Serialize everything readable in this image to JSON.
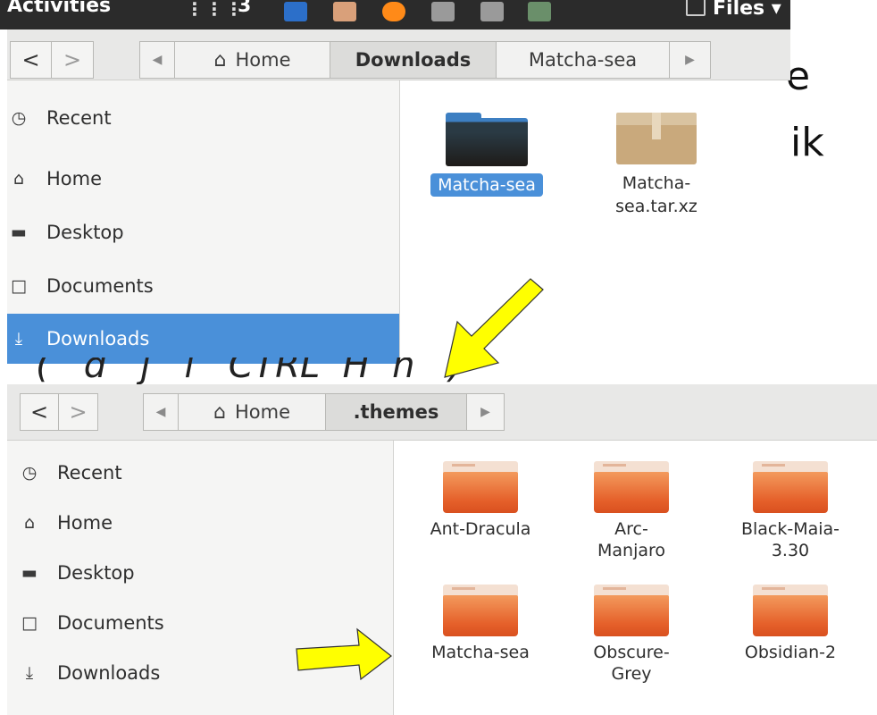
{
  "topbar": {
    "activities": "Activities",
    "workspace": "3",
    "app_menu": "Files ▾"
  },
  "background_text": {
    "line1_fragment": "e",
    "line2_fragment": "ik",
    "line3_fragment": "(   d   j   i   CTRL  H  h   )"
  },
  "window1": {
    "nav": {
      "back": "<",
      "forward": ">"
    },
    "crumbs": [
      {
        "label": "Home",
        "icon": "home-icon"
      },
      {
        "label": "Downloads",
        "active": true
      },
      {
        "label": "Matcha-sea"
      }
    ],
    "sidebar": [
      {
        "label": "Recent",
        "icon": "clock-icon",
        "glyph": "◷"
      },
      {
        "label": "Home",
        "icon": "home-icon",
        "glyph": "⌂"
      },
      {
        "label": "Desktop",
        "icon": "folder-icon",
        "glyph": "▬"
      },
      {
        "label": "Documents",
        "icon": "document-icon",
        "glyph": "□"
      },
      {
        "label": "Downloads",
        "icon": "download-icon",
        "glyph": "⤓",
        "selected": true
      }
    ],
    "files": [
      {
        "name": "Matcha-sea",
        "type": "folder",
        "selected": true
      },
      {
        "name_line1": "Matcha-",
        "name_line2": "sea.tar.xz",
        "type": "archive"
      }
    ]
  },
  "window2": {
    "nav": {
      "back": "<",
      "forward": ">"
    },
    "crumbs": [
      {
        "label": "Home",
        "icon": "home-icon"
      },
      {
        "label": ".themes",
        "active": true
      }
    ],
    "sidebar": [
      {
        "label": "Recent",
        "icon": "clock-icon",
        "glyph": "◷"
      },
      {
        "label": "Home",
        "icon": "home-icon",
        "glyph": "⌂"
      },
      {
        "label": "Desktop",
        "icon": "folder-icon",
        "glyph": "▬"
      },
      {
        "label": "Documents",
        "icon": "document-icon",
        "glyph": "□"
      },
      {
        "label": "Downloads",
        "icon": "download-icon",
        "glyph": "⤓"
      }
    ],
    "folders": [
      {
        "line1": "Ant-Dracula",
        "line2": ""
      },
      {
        "line1": "Arc-",
        "line2": "Manjaro"
      },
      {
        "line1": "Black-Maia-",
        "line2": "3.30"
      },
      {
        "line1": "Matcha-sea",
        "line2": ""
      },
      {
        "line1": "Obscure-",
        "line2": "Grey"
      },
      {
        "line1": "Obsidian-2",
        "line2": ""
      }
    ]
  },
  "colors": {
    "selection": "#4a90d9",
    "arrow_fill": "#ffff00",
    "folder_orange": "#e5602a"
  }
}
